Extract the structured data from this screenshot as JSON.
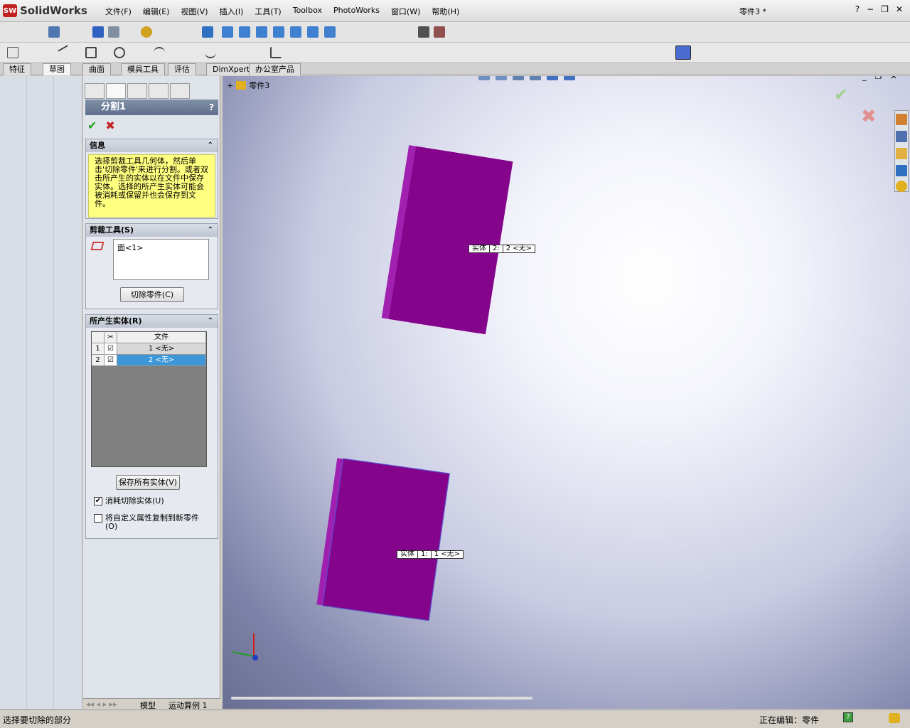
{
  "app": {
    "name": "SolidWorks",
    "doc_title": "零件3 *"
  },
  "menu": [
    "文件(F)",
    "编辑(E)",
    "视图(V)",
    "插入(I)",
    "工具(T)",
    "Toolbox",
    "PhotoWorks",
    "窗口(W)",
    "帮助(H)"
  ],
  "cmd_tabs": [
    "特征",
    "草图",
    "曲面",
    "模具工具",
    "评估",
    "DimXpert",
    "办公室产品"
  ],
  "active_tab": "草图",
  "pm": {
    "title": "分割1",
    "help": "?",
    "info_header": "信息",
    "info_text": "选择剪裁工具几何体，然后单击'切除零件'来进行分割。或者双击所产生的实体以在文件中保存实体。选择的所产生实体可能会被消耗或保留并也会保存到文件。",
    "trim_header": "剪裁工具(S)",
    "trim_item": "面<1>",
    "cut_button": "切除零件(C)",
    "bodies_header": "所产生实体(R)",
    "col_file": "文件",
    "rows": [
      {
        "num": "1",
        "file": "1 <无>"
      },
      {
        "num": "2",
        "file": "2 <无>"
      }
    ],
    "save_button": "保存所有实体(V)",
    "consume_label": "消耗切除实体(U)",
    "copy_label": "将自定义属性复制到新零件(O)"
  },
  "bottom_tabs": [
    "模型",
    "运动算例 1"
  ],
  "viewport": {
    "tree_label": "零件3",
    "callout1": {
      "name": "实体",
      "num": "2:",
      "value": "2 <无>"
    },
    "callout2": {
      "name": "实体",
      "num": "1:",
      "value": "1 <无>"
    }
  },
  "status": {
    "left": "选择要切除的部分",
    "right": "正在编辑：零件"
  }
}
